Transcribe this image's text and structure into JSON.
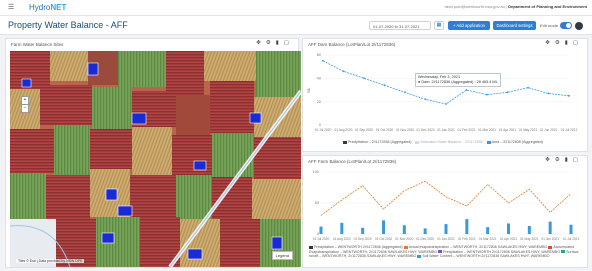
{
  "app": {
    "brand_prefix": "Hydro",
    "brand_suffix": "NET",
    "menu_icon": "hamburger-icon"
  },
  "user": {
    "email": "dewi.putri@wentworth.nsw.gov.au",
    "department": "Department of Planning and Environment"
  },
  "header": {
    "title": "Property Water Balance - AFF",
    "date_range": "01-07-2020 to 31-07-2021",
    "add_application_label": "+ Add application",
    "dashboard_settings_label": "Dashboard settings",
    "edit_mode_label": "Edit mode"
  },
  "map_panel": {
    "title": "Farm Water Balance Sites",
    "legend_label": "Legend",
    "attribution": "Tiles © Esri | Data provided by NSW DPE",
    "zoom_in": "+",
    "zoom_out": "−",
    "colors": {
      "crop_red": "#a83a3a",
      "crop_green": "#6f9a4a",
      "crop_tan": "#c9a86a",
      "water_blue": "#1a2bd6"
    }
  },
  "chart1": {
    "title": "AFF Dam Balance (LotPlan/Lot 2//1172836)",
    "tooltip_line1": "Wednesday, Feb 3, 2021",
    "tooltip_line2": "● Dam: 2//1172836 (Aggregated) : 28 483.4 ML",
    "legend": [
      {
        "label": "Precipitation – 2//1172836 (Aggregated)",
        "color": "#2f3b47"
      },
      {
        "label": "Estimated Water Balance – 2//1172836",
        "color": "#9ab8d8"
      },
      {
        "label": "Area – 2//1172836 (Aggregated)",
        "color": "#3a9ad9"
      }
    ]
  },
  "chart2": {
    "title": "AFF Farm Balance (LotPlan/Lot 2//1172836)",
    "legend": [
      {
        "label": "Precipitation – WENTWORTH 2//1172836 (Aggregated)",
        "color": "#2f3b47"
      },
      {
        "label": "Actual evapotranspiration – WENTWORTH, 2//1172836 SAWLAKES HWY, WAREMBO",
        "color": "#e07b2a"
      },
      {
        "label": "Accumulated Evapotranspiration – WENTWORTH, 2//1172836 SAWLAKES HWY, WAREMBO",
        "color": "#d84d2a"
      },
      {
        "label": "Precipitation – WENTWORTH 2//1172836 SAWLAKES HWY, WAREMBO",
        "color": "#7a56b8"
      },
      {
        "label": "Surface runoff – WENTWORTH, 2//1172836 SAWLAKES HWY, WAREMBO",
        "color": "#2da867"
      },
      {
        "label": "Soil Water Content – WENTWORTH 2//1172836 SAWLAKES HWY, WAREMBO",
        "color": "#3a9ad9"
      }
    ]
  },
  "chart_data": [
    {
      "type": "line",
      "title": "AFF Dam Balance (LotPlan/Lot 2//1172836)",
      "x": [
        "01 Jul 2020",
        "01 Aug 2020",
        "01 Sep 2020",
        "01 Oct 2020",
        "01 Nov 2020",
        "01 Dec 2020",
        "01 Jan 2021",
        "01 Feb 2021",
        "01 Mar 2021",
        "01 Apr 2021",
        "01 May 2021",
        "01 Jun 2021",
        "01 Jul 2021"
      ],
      "series": [
        {
          "name": "Area – 2//1172836 (Aggregated)",
          "values": [
            55,
            46,
            40,
            34,
            28,
            22,
            18,
            30,
            26,
            28,
            32,
            27,
            25
          ]
        }
      ],
      "ylim": [
        0,
        60
      ],
      "ylabel": "ML"
    },
    {
      "type": "bar",
      "title": "AFF Farm Balance (LotPlan/Lot 2//1172836)",
      "x": [
        "01 Jul 2020",
        "01 Aug 2020",
        "01 Sep 2020",
        "01 Oct 2020",
        "01 Nov 2020",
        "01 Dec 2020",
        "01 Jan 2021",
        "01 Feb 2021",
        "01 Mar 2021",
        "01 Apr 2021",
        "01 May 2021",
        "01 Jun 2021",
        "01 Jul 2021"
      ],
      "series": [
        {
          "name": "Actual evapotranspiration – WENTWORTH, 2//1172836 SAWLAKES HWY, WAREMBO",
          "values": [
            30,
            55,
            78,
            40,
            70,
            85,
            60,
            45,
            80,
            50,
            72,
            35,
            65
          ]
        },
        {
          "name": "Soil Water Content – WENTWORTH 2//1172836 SAWLAKES HWY, WAREMBO",
          "values": [
            12,
            18,
            10,
            22,
            14,
            9,
            16,
            24,
            11,
            17,
            13,
            20,
            15
          ]
        }
      ],
      "ylim": [
        0,
        100
      ]
    }
  ]
}
